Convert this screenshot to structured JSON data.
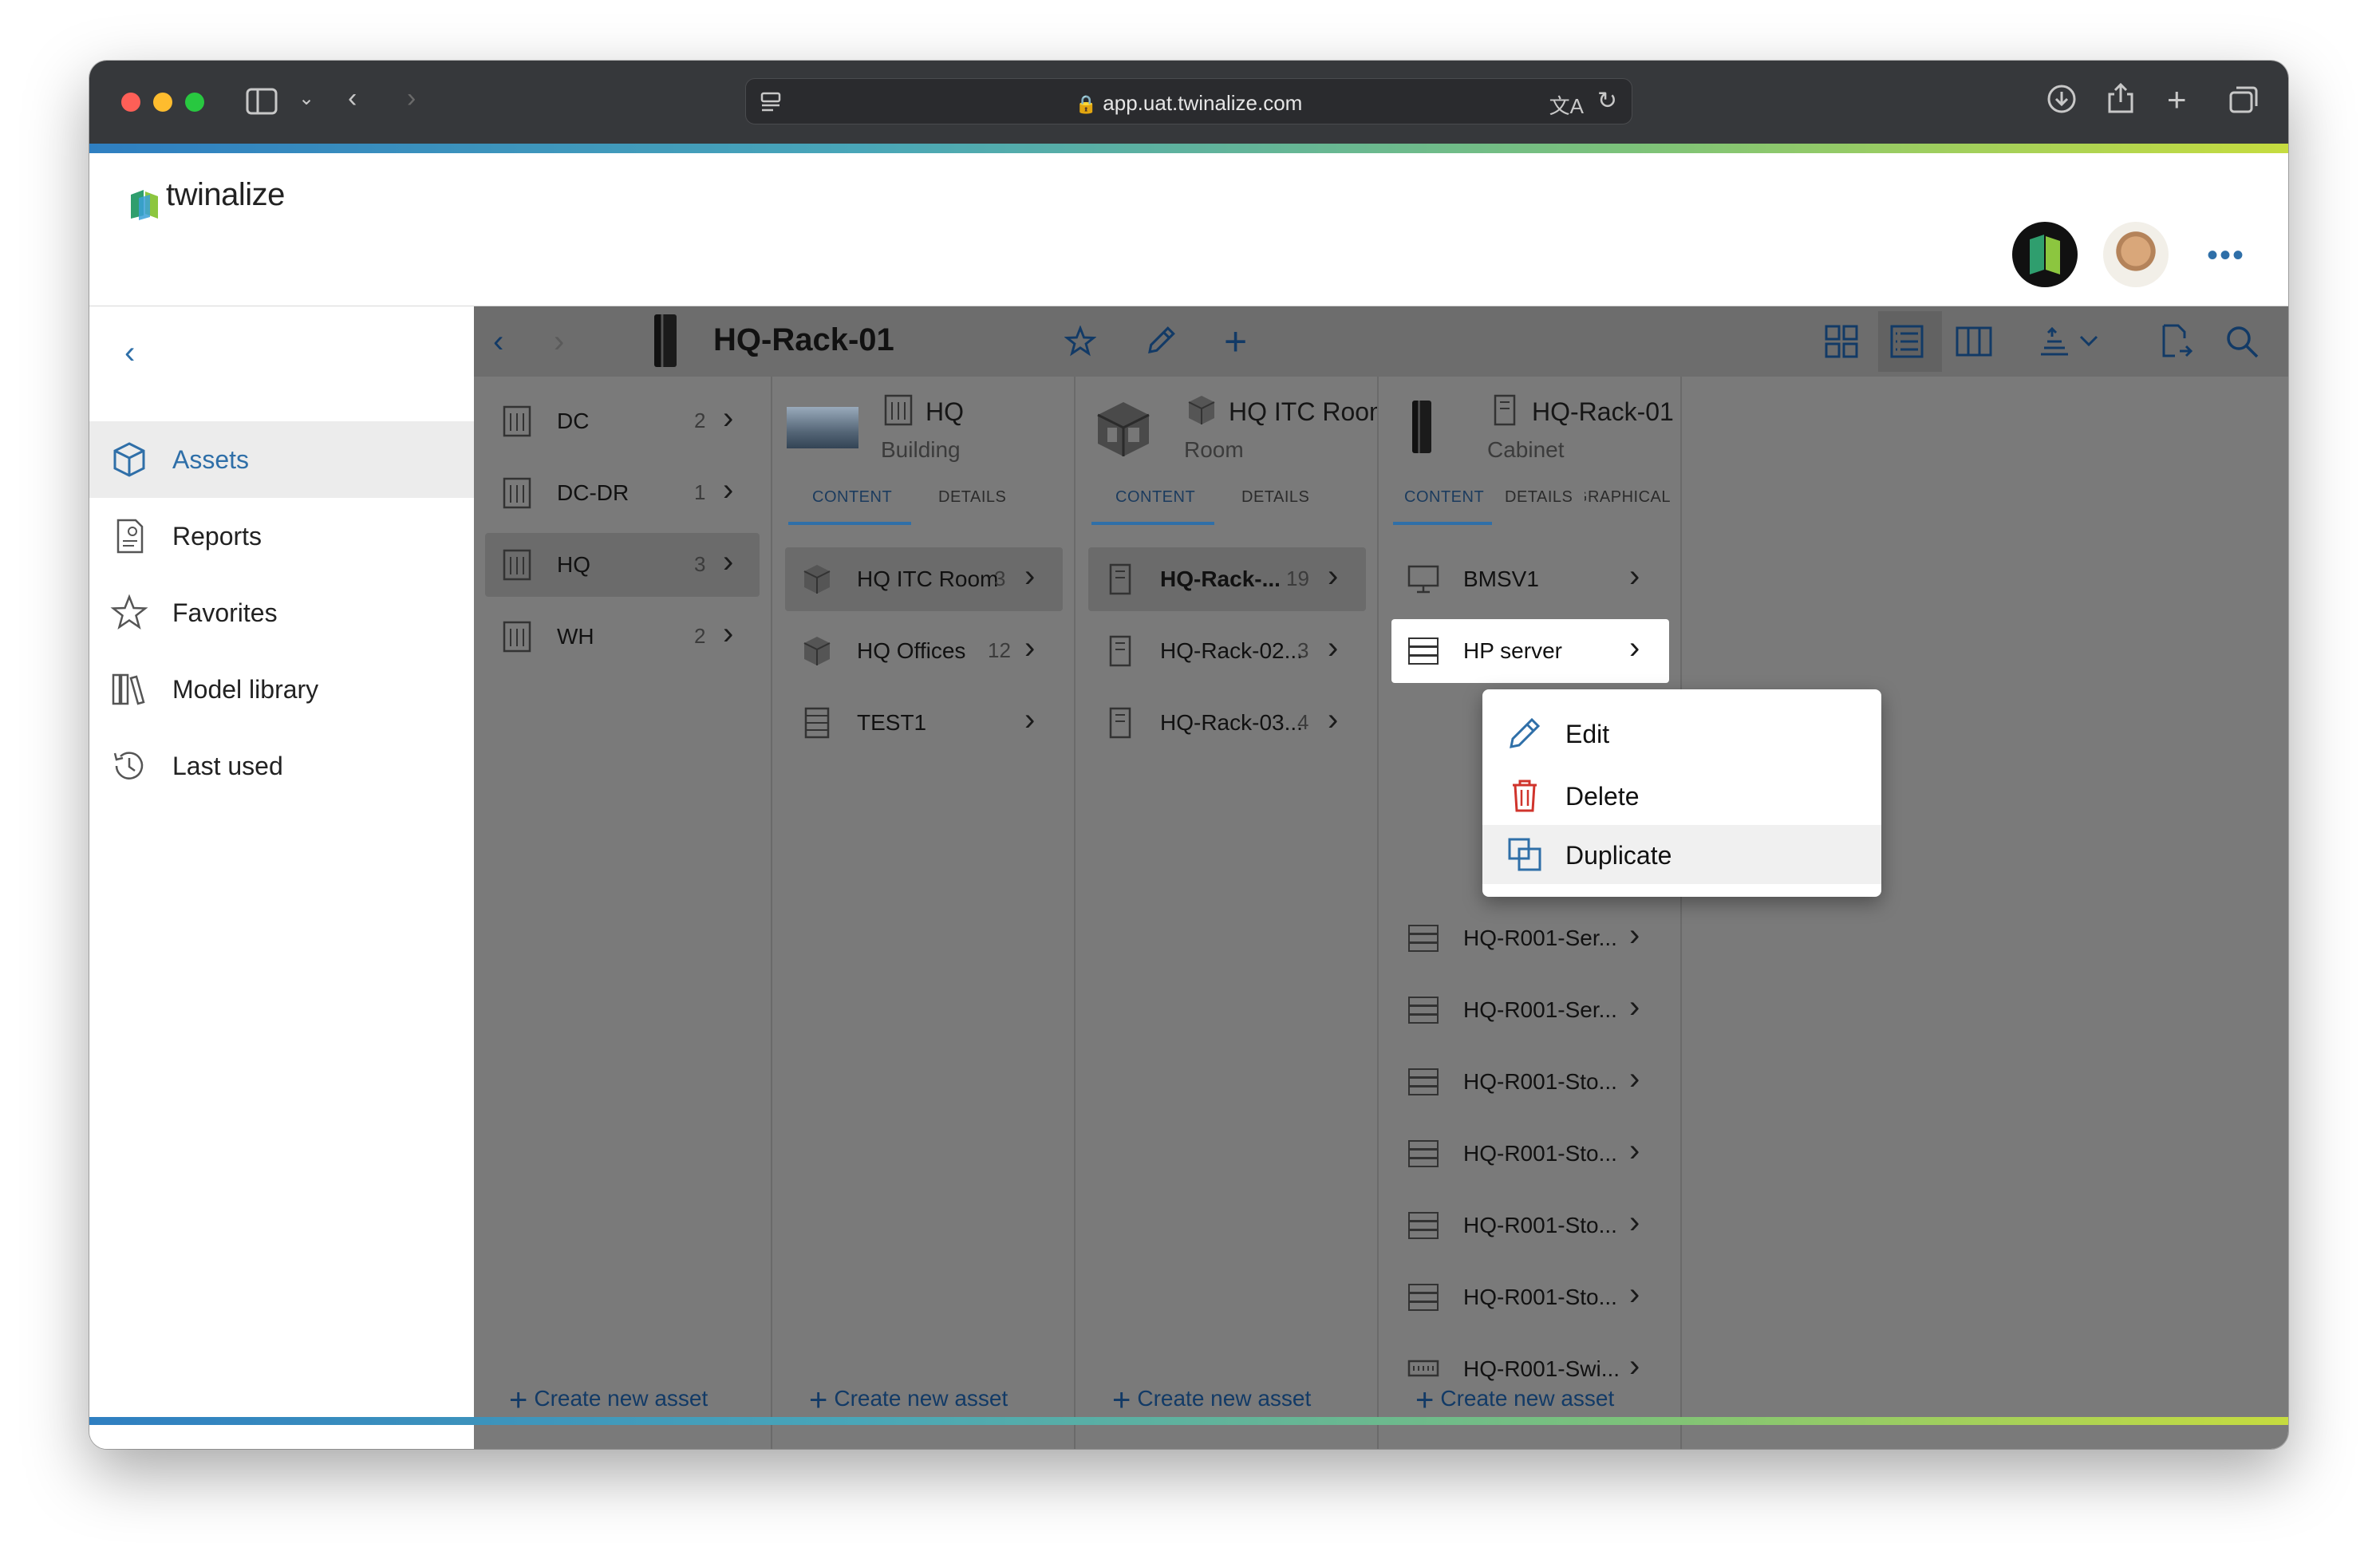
{
  "browser": {
    "url": "app.uat.twinalize.com"
  },
  "app": {
    "logo_text": "twinalize",
    "more_label": "•••"
  },
  "sidebar": {
    "back_label": "‹",
    "items": [
      {
        "label": "Assets",
        "icon": "cube-icon",
        "active": true
      },
      {
        "label": "Reports",
        "icon": "report-icon",
        "active": false
      },
      {
        "label": "Favorites",
        "icon": "star-icon",
        "active": false
      },
      {
        "label": "Model library",
        "icon": "library-icon",
        "active": false
      },
      {
        "label": "Last used",
        "icon": "history-icon",
        "active": false
      }
    ]
  },
  "toolbar": {
    "title": "HQ-Rack-01"
  },
  "columns": [
    {
      "rows": [
        {
          "label": "DC",
          "count": "2"
        },
        {
          "label": "DC-DR",
          "count": "1"
        },
        {
          "label": "HQ",
          "count": "3"
        },
        {
          "label": "WH",
          "count": "2"
        }
      ],
      "create_label": "Create new asset"
    },
    {
      "title": "HQ",
      "subtitle": "Building",
      "tabs": [
        "CONTENT",
        "DETAILS"
      ],
      "rows": [
        {
          "label": "HQ ITC Room",
          "count": "3"
        },
        {
          "label": "HQ Offices",
          "count": "12"
        },
        {
          "label": "TEST1",
          "count": ""
        }
      ],
      "create_label": "Create new asset"
    },
    {
      "title": "HQ ITC Room",
      "subtitle": "Room",
      "tabs": [
        "CONTENT",
        "DETAILS"
      ],
      "rows": [
        {
          "label": "HQ-Rack-...",
          "count": "19"
        },
        {
          "label": "HQ-Rack-02...",
          "count": "3"
        },
        {
          "label": "HQ-Rack-03...",
          "count": "4"
        }
      ],
      "create_label": "Create new asset"
    },
    {
      "title": "HQ-Rack-01",
      "subtitle": "Cabinet",
      "tabs": [
        "CONTENT",
        "DETAILS",
        "GRAPHICAL"
      ],
      "rows": [
        {
          "label": "BMSV1"
        },
        {
          "label": "HP server"
        },
        {
          "label": "HQ-R001-Ser..."
        },
        {
          "label": "HQ-R001-Ser..."
        },
        {
          "label": "HQ-R001-Sto..."
        },
        {
          "label": "HQ-R001-Sto..."
        },
        {
          "label": "HQ-R001-Sto..."
        },
        {
          "label": "HQ-R001-Sto..."
        },
        {
          "label": "HQ-R001-Swi..."
        }
      ],
      "create_label": "Create new asset"
    }
  ],
  "context_menu": {
    "items": [
      {
        "label": "Edit",
        "icon": "pencil-icon"
      },
      {
        "label": "Delete",
        "icon": "trash-icon",
        "color": "#d0342c"
      },
      {
        "label": "Duplicate",
        "icon": "duplicate-icon"
      }
    ]
  },
  "colors": {
    "accent": "#2f6fa8",
    "danger": "#d0342c",
    "overlay": "#7a7a7a"
  }
}
